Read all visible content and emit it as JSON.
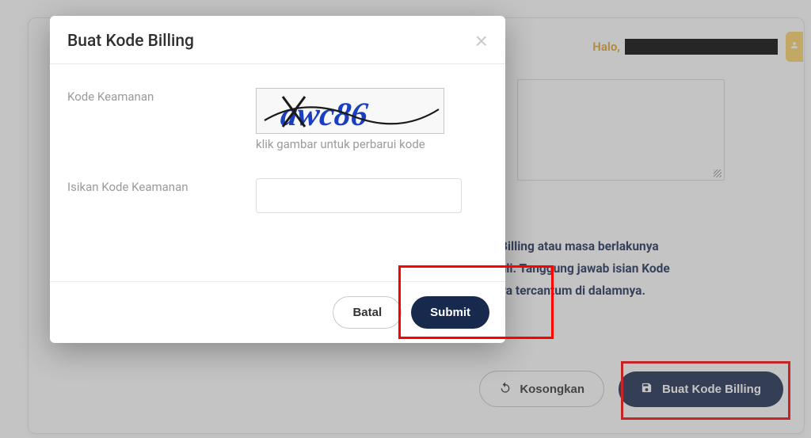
{
  "header": {
    "greeting": "Halo,"
  },
  "background": {
    "note_line1": "Billing atau masa berlakunya",
    "note_line2": "ali. Tanggung jawab isian Kode",
    "note_line3": "ya tercantum di dalamnya.",
    "kosongkan_label": "Kosongkan",
    "buat_label": "Buat Kode Billing"
  },
  "modal": {
    "title": "Buat Kode Billing",
    "label_kode": "Kode Keamanan",
    "captcha_hint": "klik gambar untuk perbarui kode",
    "captcha_text": "awc86",
    "label_isikan": "Isikan Kode Keamanan",
    "batal_label": "Batal",
    "submit_label": "Submit"
  }
}
